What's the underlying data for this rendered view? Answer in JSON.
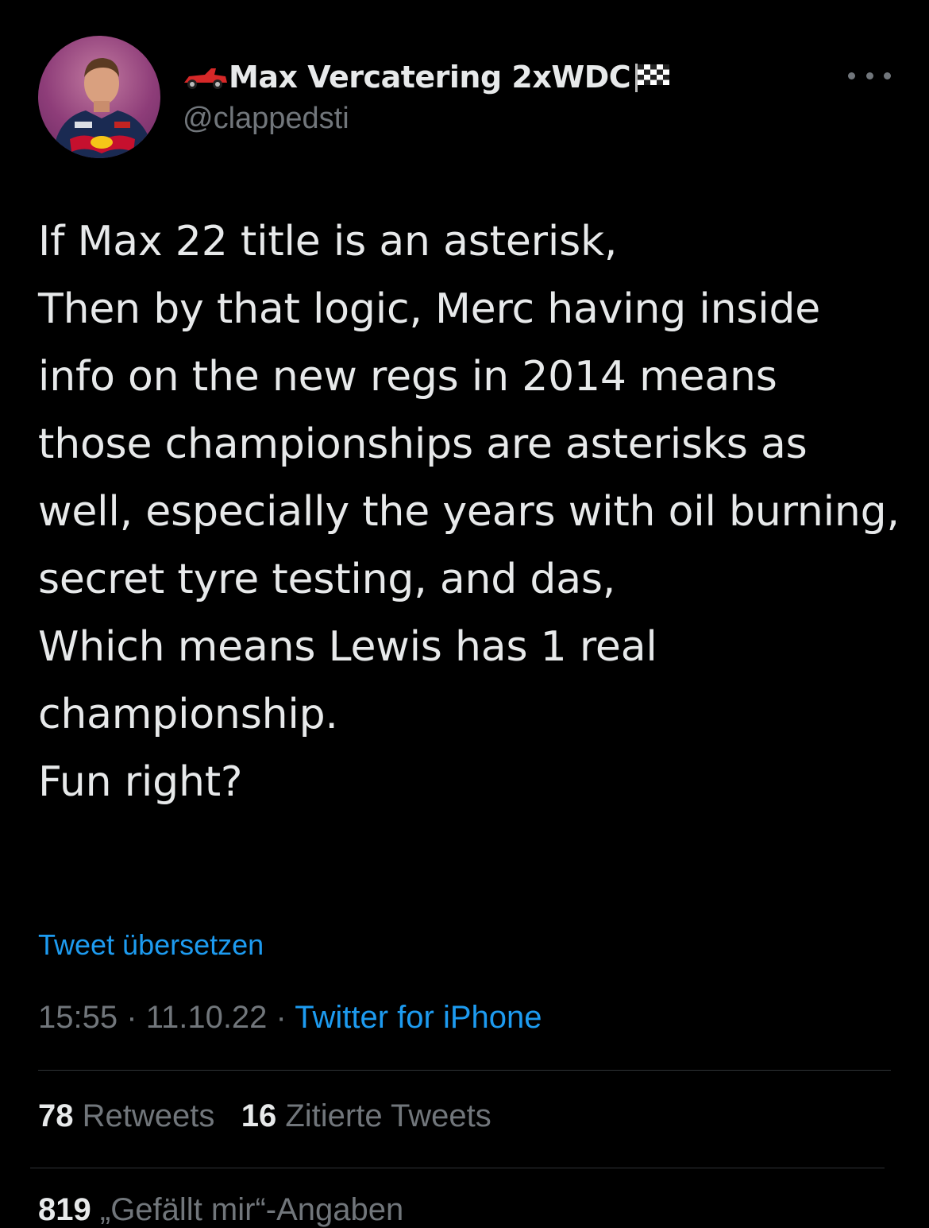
{
  "author": {
    "display_name": "Max Vercatering 2xWDC",
    "handle": "@clappedsti",
    "avatar_icon": "profile-photo",
    "name_prefix_icon": "race-car-emoji",
    "name_suffix_icon": "checkered-flag-emoji"
  },
  "tweet": {
    "paragraphs": [
      "If Max 22 title is an asterisk,",
      "Then by that logic, Merc having inside info on the new regs in 2014 means those championships are asterisks as well, especially the years with oil burning, secret tyre testing, and das,",
      "Which means Lewis has 1 real championship.",
      "Fun right?"
    ],
    "translate_label": "Tweet übersetzen",
    "time": "15:55",
    "date": "11.10.22",
    "separator": "·",
    "source": "Twitter for iPhone"
  },
  "stats": {
    "retweets_count": "78",
    "retweets_label": "Retweets",
    "quotes_count": "16",
    "quotes_label": "Zitierte Tweets",
    "likes_count": "819",
    "likes_label": "„Gefällt mir“-Angaben"
  },
  "colors": {
    "background": "#000000",
    "text": "#e7e9ea",
    "secondary": "#71767b",
    "link": "#1d9bf0",
    "divider": "#2f3336"
  }
}
